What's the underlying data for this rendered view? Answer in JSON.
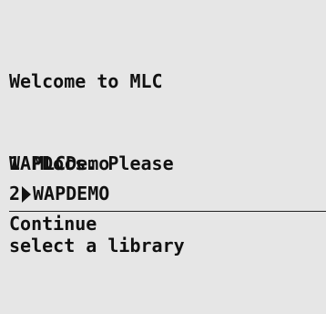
{
  "welcome_lines": [
    "Welcome to MLC",
    "WAPDocs. Please",
    "select a library"
  ],
  "libraries": [
    {
      "number": "1",
      "name": "MLCDemo",
      "selected": false
    },
    {
      "number": "2",
      "name": "WAPDEMO",
      "selected": true
    }
  ],
  "softkey": {
    "label": "Continue"
  },
  "selection_marker_icon": "right-triangle-icon",
  "colors": {
    "background": "#e6e6e6",
    "text": "#111111"
  }
}
